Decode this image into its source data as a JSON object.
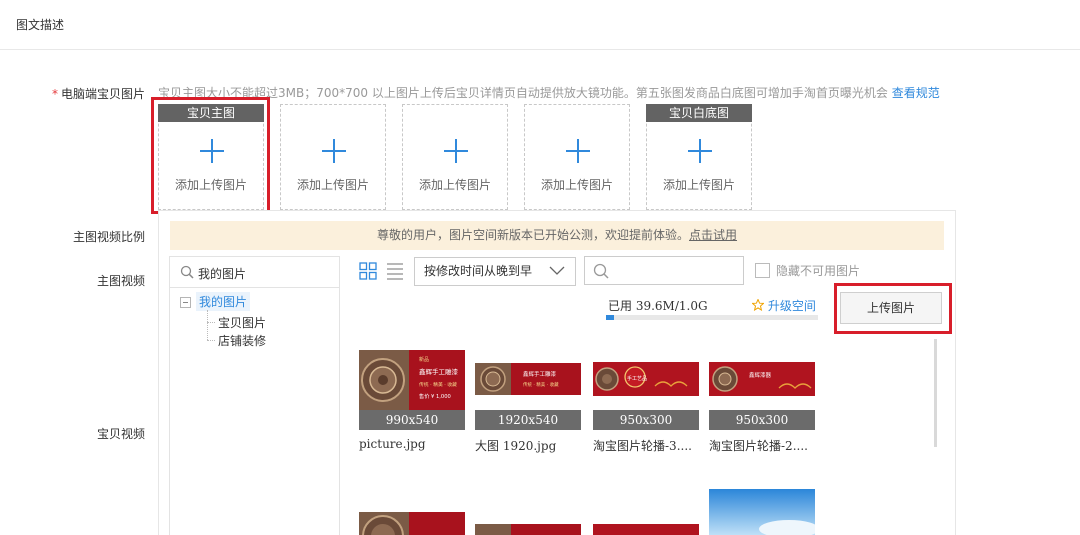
{
  "section": {
    "title": "图文描述"
  },
  "main_images": {
    "label": "电脑端宝贝图片",
    "hint": "宝贝主图大小不能超过3MB；700*700 以上图片上传后宝贝详情页自动提供放大镜功能。第五张图发商品白底图可增加手淘首页曝光机会",
    "hint_link": "查看规范",
    "slots": [
      {
        "badge": "宝贝主图",
        "label": "添加上传图片"
      },
      {
        "badge": "",
        "label": "添加上传图片"
      },
      {
        "badge": "",
        "label": "添加上传图片"
      },
      {
        "badge": "",
        "label": "添加上传图片"
      },
      {
        "badge": "宝贝白底图",
        "label": "添加上传图片"
      }
    ]
  },
  "labels": {
    "video_ratio": "主图视频比例",
    "main_video": "主图视频",
    "item_video": "宝贝视频"
  },
  "picker": {
    "notice": "尊敬的用户，图片空间新版本已开始公测，欢迎提前体验。",
    "notice_link": "点击试用",
    "tree_search": "我的图片",
    "tree_root": "我的图片",
    "tree_children": [
      "宝贝图片",
      "店铺装修"
    ],
    "sort_selected": "按修改时间从晚到早",
    "search_placeholder": "",
    "hide_unusable": "隐藏不可用图片",
    "usage": "已用 39.6M/1.0G",
    "usage_fraction": 0.04,
    "upgrade": "升级空间",
    "upload_button": "上传图片",
    "thumbs": [
      {
        "dims": "990x540",
        "name": "picture.jpg"
      },
      {
        "dims": "1920x540",
        "name": "大图 1920.jpg"
      },
      {
        "dims": "950x300",
        "name": "淘宝图片轮播-3...."
      },
      {
        "dims": "950x300",
        "name": "淘宝图片轮播-2...."
      }
    ],
    "thumb_captions": [
      [
        "新品",
        "鑫辉手工雕漆",
        "传统 · 精美 · 收藏",
        "售价 ¥ 1,000"
      ],
      [
        "鑫辉手工雕漆",
        "传统 · 精美 · 收藏"
      ],
      [
        "手工艺品"
      ],
      [
        "鑫辉漆器"
      ]
    ]
  },
  "colors": {
    "accent": "#3089dc",
    "highlight": "#d81e2a",
    "banner": "#a8121d",
    "notice_bg": "#fbf0dc"
  }
}
